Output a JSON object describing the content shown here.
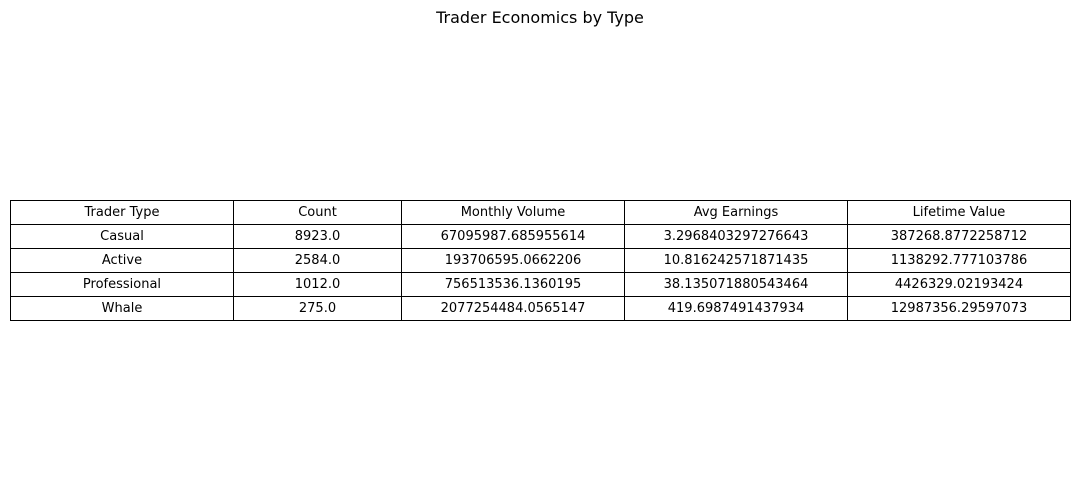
{
  "chart_data": {
    "type": "table",
    "title": "Trader Economics by Type",
    "columns": [
      "Trader Type",
      "Count",
      "Monthly Volume",
      "Avg Earnings",
      "Lifetime Value"
    ],
    "rows": [
      [
        "Casual",
        "8923.0",
        "67095987.685955614",
        "3.2968403297276643",
        "387268.8772258712"
      ],
      [
        "Active",
        "2584.0",
        "193706595.0662206",
        "10.816242571871435",
        "1138292.777103786"
      ],
      [
        "Professional",
        "1012.0",
        "756513536.1360195",
        "38.135071880543464",
        "4426329.02193424"
      ],
      [
        "Whale",
        "275.0",
        "2077254484.0565147",
        "419.6987491437934",
        "12987356.29597073"
      ]
    ]
  }
}
